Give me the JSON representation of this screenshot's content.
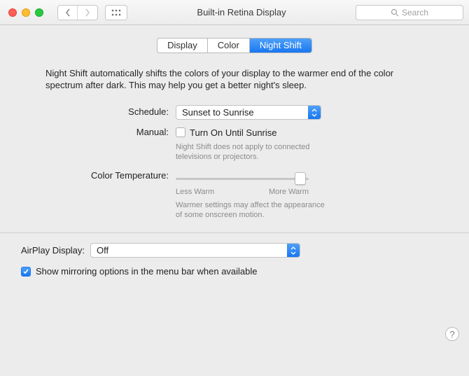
{
  "window": {
    "title": "Built-in Retina Display",
    "search_placeholder": "Search"
  },
  "tabs": {
    "display": "Display",
    "color": "Color",
    "night_shift": "Night Shift"
  },
  "night_shift": {
    "description": "Night Shift automatically shifts the colors of your display to the warmer end of the color spectrum after dark. This may help you get a better night's sleep.",
    "schedule_label": "Schedule:",
    "schedule_value": "Sunset to Sunrise",
    "manual_label": "Manual:",
    "manual_checkbox_label": "Turn On Until Sunrise",
    "manual_note": "Night Shift does not apply to connected televisions or projectors.",
    "color_temp_label": "Color Temperature:",
    "slider_min": "Less Warm",
    "slider_max": "More Warm",
    "color_temp_note": "Warmer settings may affect the appearance of some onscreen motion."
  },
  "airplay": {
    "label": "AirPlay Display:",
    "value": "Off"
  },
  "mirror": {
    "label": "Show mirroring options in the menu bar when available"
  },
  "help_glyph": "?"
}
